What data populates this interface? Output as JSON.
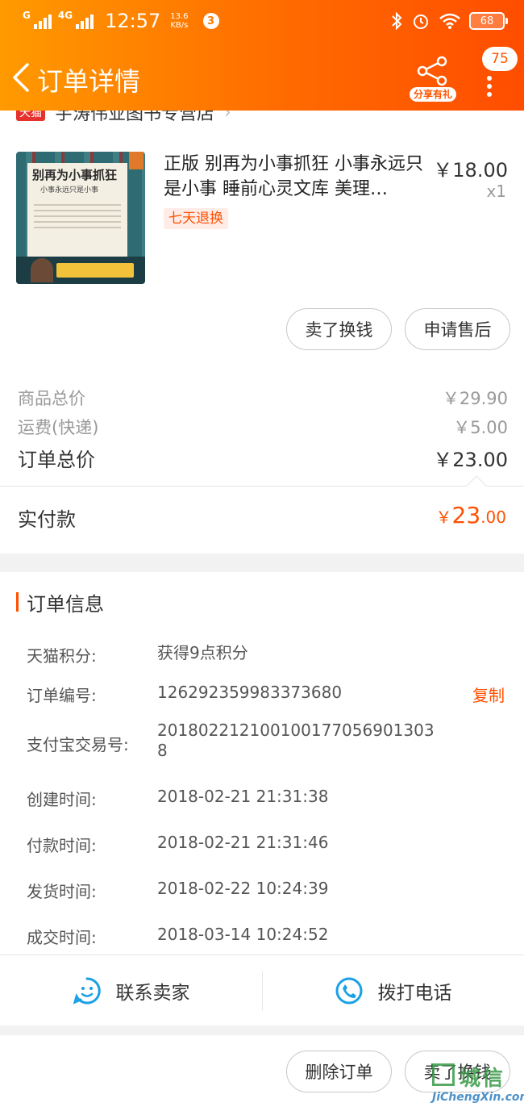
{
  "status_bar": {
    "network": "4G",
    "network_small": "G",
    "time": "12:57",
    "speed_value": "13.6",
    "speed_unit": "KB/s",
    "notification_count": "3",
    "battery": "68"
  },
  "nav": {
    "title": "订单详情",
    "share_label": "分享有礼",
    "message_count": "75"
  },
  "store": {
    "tag": "天猫",
    "name": "宇涛伟业图书专营店"
  },
  "product": {
    "title": "正版 别再为小事抓狂 小事永远只是小事 睡前心灵文库 美理…",
    "price": "￥18.00",
    "quantity": "x1",
    "tag": "七天退换",
    "cover_title": "别再为小事抓狂",
    "cover_subtitle": "小事永远只是小事",
    "actions": {
      "resell": "卖了换钱",
      "after_sale": "申请售后"
    }
  },
  "prices": {
    "goods_total_label": "商品总价",
    "goods_total": "￥29.90",
    "shipping_label": "运费(快递)",
    "shipping": "￥5.00",
    "order_total_label": "订单总价",
    "order_total": "￥23.00",
    "paid_label": "实付款",
    "paid_symbol": "￥",
    "paid_int": "23",
    "paid_dec": ".00"
  },
  "order_info": {
    "heading": "订单信息",
    "copy_label": "复制",
    "rows": [
      {
        "key": "天猫积分:",
        "value": "获得9点积分"
      },
      {
        "key": "订单编号:",
        "value": "126292359983373680"
      },
      {
        "key": "支付宝交易号:",
        "value": "2018022121001001770569013038"
      },
      {
        "key": "创建时间:",
        "value": "2018-02-21 21:31:38"
      },
      {
        "key": "付款时间:",
        "value": "2018-02-21 21:31:46"
      },
      {
        "key": "发货时间:",
        "value": "2018-02-22 10:24:39"
      },
      {
        "key": "成交时间:",
        "value": "2018-03-14 10:24:52"
      }
    ]
  },
  "contact": {
    "seller": "联系卖家",
    "call": "拨打电话"
  },
  "bottom_actions": {
    "delete": "删除订单",
    "resell": "卖了换钱"
  },
  "watermark": {
    "cn": "城信",
    "en": "JiChengXin.com"
  }
}
